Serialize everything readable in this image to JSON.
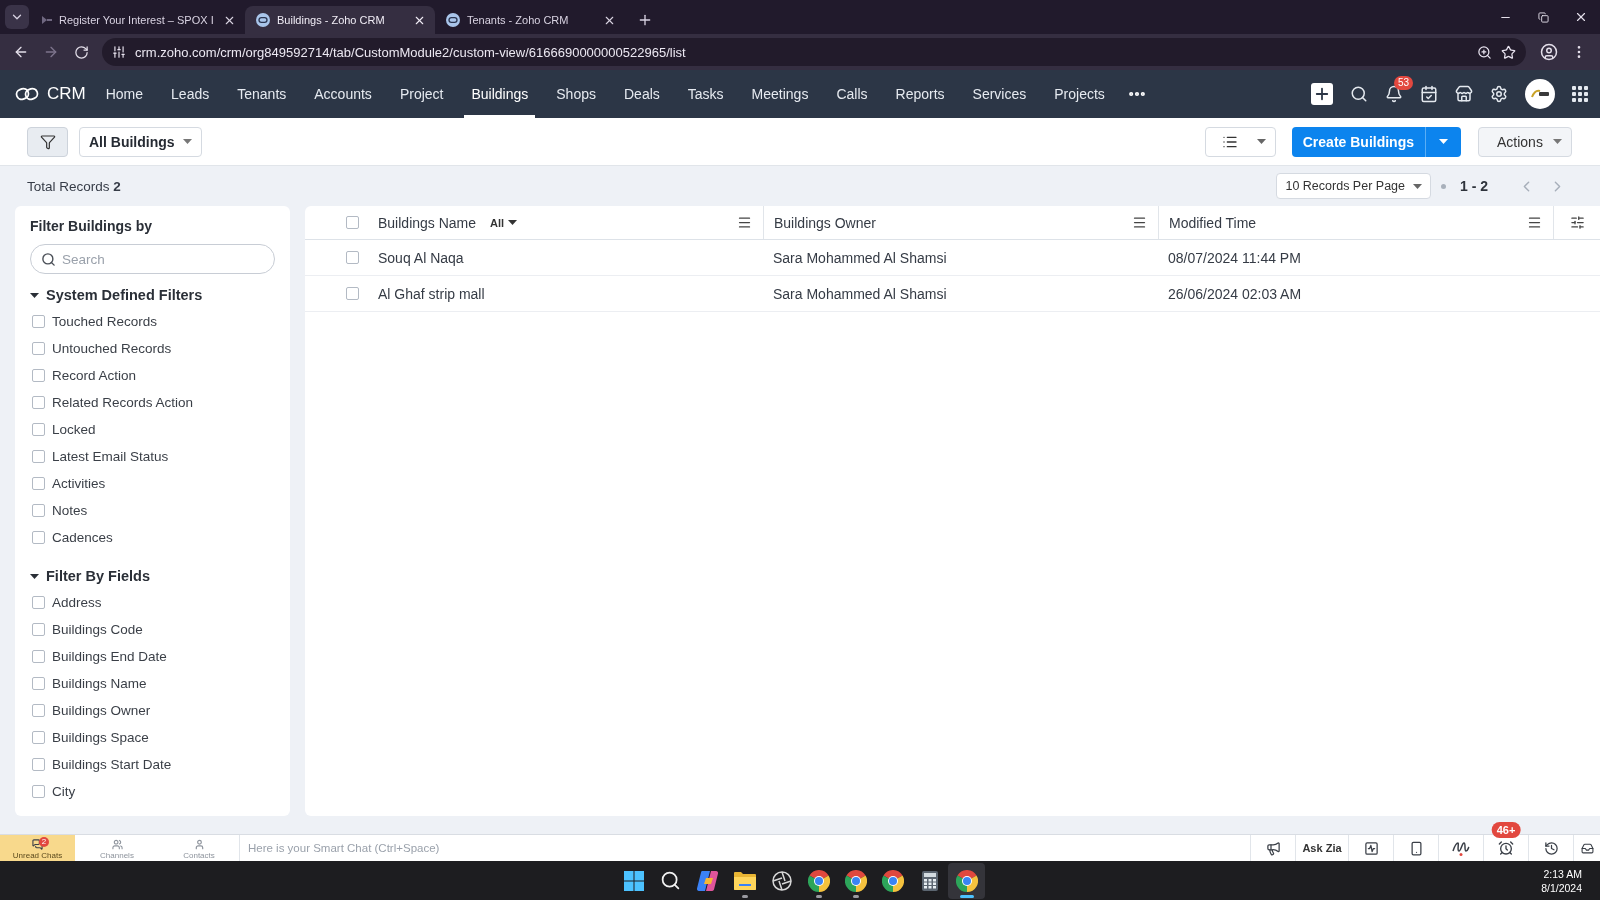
{
  "browser": {
    "tabs": [
      {
        "kind": "site",
        "title": "Register Your Interest – SPOX I",
        "selected": false
      },
      {
        "kind": "crm",
        "title": "Buildings - Zoho CRM",
        "selected": true
      },
      {
        "kind": "crm",
        "title": "Tenants - Zoho CRM",
        "selected": false
      }
    ],
    "url": "crm.zoho.com/crm/org849592714/tab/CustomModule2/custom-view/6166690000000522965/list"
  },
  "crm_nav": {
    "logo": "CRM",
    "items": [
      {
        "label": "Home",
        "selected": false
      },
      {
        "label": "Leads",
        "selected": false
      },
      {
        "label": "Tenants",
        "selected": false
      },
      {
        "label": "Accounts",
        "selected": false
      },
      {
        "label": "Project",
        "selected": false
      },
      {
        "label": "Buildings",
        "selected": true
      },
      {
        "label": "Shops",
        "selected": false
      },
      {
        "label": "Deals",
        "selected": false
      },
      {
        "label": "Tasks",
        "selected": false
      },
      {
        "label": "Meetings",
        "selected": false
      },
      {
        "label": "Calls",
        "selected": false
      },
      {
        "label": "Reports",
        "selected": false
      },
      {
        "label": "Services",
        "selected": false
      },
      {
        "label": "Projects",
        "selected": false
      }
    ],
    "notification_count": "53"
  },
  "toolbar": {
    "view_name": "All Buildings",
    "create_label": "Create Buildings",
    "actions_label": "Actions"
  },
  "summary": {
    "total_records": "Total Records **2**",
    "per_page": "10 Records Per Page",
    "range": "1 - 2"
  },
  "sidebar": {
    "title": "Filter Buildings by",
    "search": {
      "placeholder": "Search"
    },
    "sections": [
      {
        "title": "System Defined Filters",
        "expanded": true,
        "items": [
          {
            "label": "Touched Records",
            "checked": false
          },
          {
            "label": "Untouched Records",
            "checked": false
          },
          {
            "label": "Record Action",
            "checked": false
          },
          {
            "label": "Related Records Action",
            "checked": false
          },
          {
            "label": "Locked",
            "checked": false
          },
          {
            "label": "Latest Email Status",
            "checked": false
          },
          {
            "label": "Activities",
            "checked": false
          },
          {
            "label": "Notes",
            "checked": false
          },
          {
            "label": "Cadences",
            "checked": false
          }
        ]
      },
      {
        "title": "Filter By Fields",
        "expanded": true,
        "items": [
          {
            "label": "Address",
            "checked": false
          },
          {
            "label": "Buildings Code",
            "checked": false
          },
          {
            "label": "Buildings End Date",
            "checked": false
          },
          {
            "label": "Buildings Name",
            "checked": false
          },
          {
            "label": "Buildings Owner",
            "checked": false
          },
          {
            "label": "Buildings Space",
            "checked": false
          },
          {
            "label": "Buildings Start Date",
            "checked": false
          },
          {
            "label": "City",
            "checked": false
          }
        ]
      }
    ]
  },
  "table": {
    "all_checked": false,
    "columns": [
      {
        "label": "Buildings Name",
        "filter": "All"
      },
      {
        "label": "Buildings Owner"
      },
      {
        "label": "Modified Time"
      }
    ],
    "rows": [
      {
        "checked": false,
        "cells": [
          "Souq Al Naqa",
          "Sara Mohammed Al Shamsi",
          "08/07/2024 11:44 PM"
        ]
      },
      {
        "checked": false,
        "cells": [
          "Al Ghaf strip mall",
          "Sara Mohammed Al Shamsi",
          "26/06/2024 02:03 AM"
        ]
      }
    ]
  },
  "chat_bar": {
    "tabs": [
      {
        "kind": "chats",
        "label": "Unread Chats",
        "badge": "2",
        "selected": true
      },
      {
        "kind": "channels",
        "label": "Channels",
        "selected": false
      },
      {
        "kind": "contacts",
        "label": "Contacts",
        "selected": false
      }
    ],
    "placeholder": "Here is your Smart Chat (Ctrl+Space)",
    "ask_zia": "Ask Zia",
    "reminder_badge": "46+"
  },
  "taskbar": {
    "apps": [
      {
        "kind": "start",
        "open": false,
        "active": false
      },
      {
        "kind": "search",
        "open": false,
        "active": false
      },
      {
        "kind": "copilot",
        "open": false,
        "active": false
      },
      {
        "kind": "folder",
        "open": true,
        "active": false
      },
      {
        "kind": "aperture",
        "open": false,
        "active": false
      },
      {
        "kind": "chrome",
        "open": true,
        "active": false
      },
      {
        "kind": "chrome",
        "open": true,
        "active": false
      },
      {
        "kind": "chrome",
        "open": false,
        "active": false
      },
      {
        "kind": "calculator",
        "open": false,
        "active": false
      },
      {
        "kind": "chrome",
        "open": true,
        "active": true
      }
    ],
    "time": "2:13 AM",
    "date": "8/1/2024"
  }
}
